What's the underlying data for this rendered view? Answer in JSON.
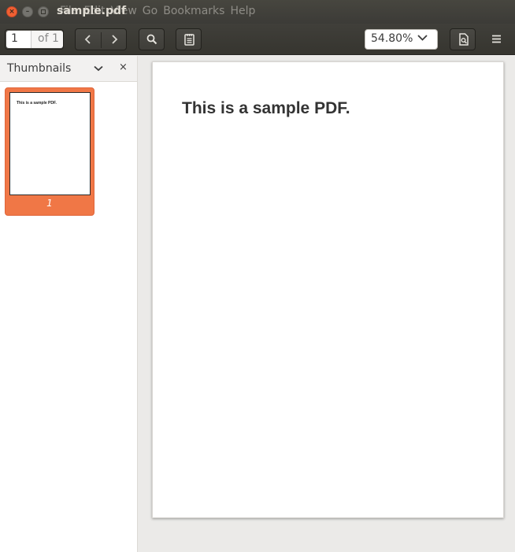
{
  "window": {
    "title": "sample.pdf",
    "menus": [
      "File",
      "Edit",
      "View",
      "Go",
      "Bookmarks",
      "Help"
    ]
  },
  "toolbar": {
    "page_current": "1",
    "page_total": "of 1",
    "zoom": "54.80%"
  },
  "sidebar": {
    "title": "Thumbnails",
    "thumbnails": [
      {
        "page_label": "1",
        "preview_text": "This is a sample PDF."
      }
    ]
  },
  "document": {
    "heading": "This is a sample PDF."
  },
  "colors": {
    "accent": "#f07746",
    "titlebar": "#3c3b37",
    "close_button": "#f16032"
  },
  "icons": [
    "close-icon",
    "minimize-icon",
    "maximize-icon",
    "chevron-left-icon",
    "chevron-right-icon",
    "search-icon",
    "annotations-icon",
    "chevron-down-icon",
    "document-properties-icon",
    "hamburger-menu-icon"
  ]
}
